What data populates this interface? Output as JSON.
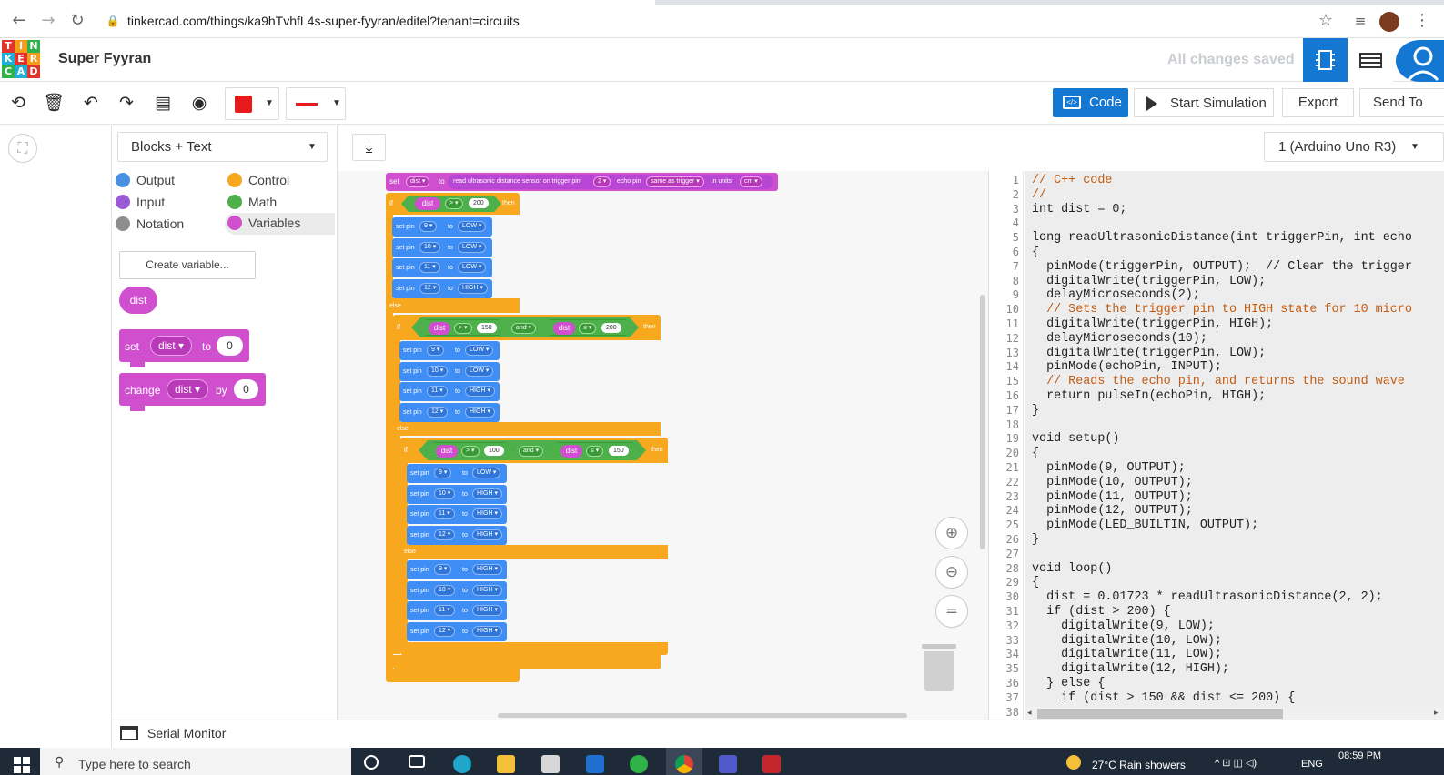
{
  "browser": {
    "url": "tinkercad.com/things/ka9hTvhfL4s-super-fyyran/editel?tenant=circuits"
  },
  "header": {
    "logo_letters": [
      "T",
      "I",
      "N",
      "K",
      "E",
      "R",
      "C",
      "A",
      "D"
    ],
    "project_title": "Super Fyyran",
    "save_status": "All changes saved"
  },
  "toolbar": {
    "code_label": "Code",
    "start_sim_label": "Start Simulation",
    "export_label": "Export",
    "send_label": "Send To"
  },
  "palette": {
    "mode": "Blocks + Text",
    "categories": [
      {
        "label": "Output",
        "color": "#4a90e2"
      },
      {
        "label": "Control",
        "color": "#f8a81e"
      },
      {
        "label": "Input",
        "color": "#9b59d8"
      },
      {
        "label": "Math",
        "color": "#4db04a"
      },
      {
        "label": "Notation",
        "color": "#8e8e8e"
      },
      {
        "label": "Variables",
        "color": "#cf4fcf"
      }
    ],
    "create_variable": "Create variable...",
    "var_name": "dist",
    "set_block": {
      "keyword": "set",
      "var": "dist",
      "to": "to",
      "value": "0"
    },
    "change_block": {
      "keyword": "change",
      "var": "dist",
      "by": "by",
      "value": "0"
    }
  },
  "editor": {
    "board": "1 (Arduino Uno R3)"
  },
  "blocks": {
    "set_label": "set",
    "var": "dist",
    "to": "to",
    "sensor_text": "read ultrasonic distance sensor on trigger pin",
    "trigger_pin": "2",
    "echo_label": "echo pin",
    "echo_value": "same as trigger",
    "units_label": "in units",
    "units": "cm",
    "if": "if",
    "else": "else",
    "then": "then",
    "and": "and",
    "setpin": "set pin",
    "gt": ">",
    "le": "≤",
    "n200": "200",
    "n150": "150",
    "n100": "100",
    "pins": [
      "9",
      "10",
      "11",
      "12"
    ],
    "group1": [
      "LOW",
      "LOW",
      "LOW",
      "HIGH"
    ],
    "group2": [
      "LOW",
      "LOW",
      "HIGH",
      "HIGH"
    ],
    "group3": [
      "LOW",
      "HIGH",
      "HIGH",
      "HIGH"
    ],
    "group4": [
      "HIGH",
      "HIGH",
      "HIGH",
      "HIGH"
    ]
  },
  "code": {
    "line_numbers": [
      "1",
      "2",
      "3",
      "4",
      "5",
      "6",
      "7",
      "8",
      "9",
      "10",
      "11",
      "12",
      "13",
      "14",
      "15",
      "16",
      "17",
      "18",
      "19",
      "20",
      "21",
      "22",
      "23",
      "24",
      "25",
      "26",
      "27",
      "28",
      "29",
      "30",
      "31",
      "32",
      "33",
      "34",
      "35",
      "36",
      "37",
      "38"
    ],
    "lines": [
      "// C++ code",
      "//",
      "int dist = 0;",
      "",
      "long readUltrasonicDistance(int triggerPin, int echo",
      "{",
      "  pinMode(triggerPin, OUTPUT);  // Clear the trigger",
      "  digitalWrite(triggerPin, LOW);",
      "  delayMicroseconds(2);",
      "  // Sets the trigger pin to HIGH state for 10 micro",
      "  digitalWrite(triggerPin, HIGH);",
      "  delayMicroseconds(10);",
      "  digitalWrite(triggerPin, LOW);",
      "  pinMode(echoPin, INPUT);",
      "  // Reads the echo pin, and returns the sound wave",
      "  return pulseIn(echoPin, HIGH);",
      "}",
      "",
      "void setup()",
      "{",
      "  pinMode(9, OUTPUT);",
      "  pinMode(10, OUTPUT);",
      "  pinMode(11, OUTPUT);",
      "  pinMode(12, OUTPUT);",
      "  pinMode(LED_BUILTIN, OUTPUT);",
      "}",
      "",
      "void loop()",
      "{",
      "  dist = 0.01723 * readUltrasonicDistance(2, 2);",
      "  if (dist > 200) {",
      "    digitalWrite(9, LOW);",
      "    digitalWrite(10, LOW);",
      "    digitalWrite(11, LOW);",
      "    digitalWrite(12, HIGH);",
      "  } else {",
      "    if (dist > 150 && dist <= 200) {",
      ""
    ]
  },
  "serial_monitor": "Serial Monitor",
  "taskbar": {
    "search_placeholder": "Type here to search",
    "weather": "27°C  Rain showers",
    "language": "ENG",
    "time": "08:59 PM"
  }
}
